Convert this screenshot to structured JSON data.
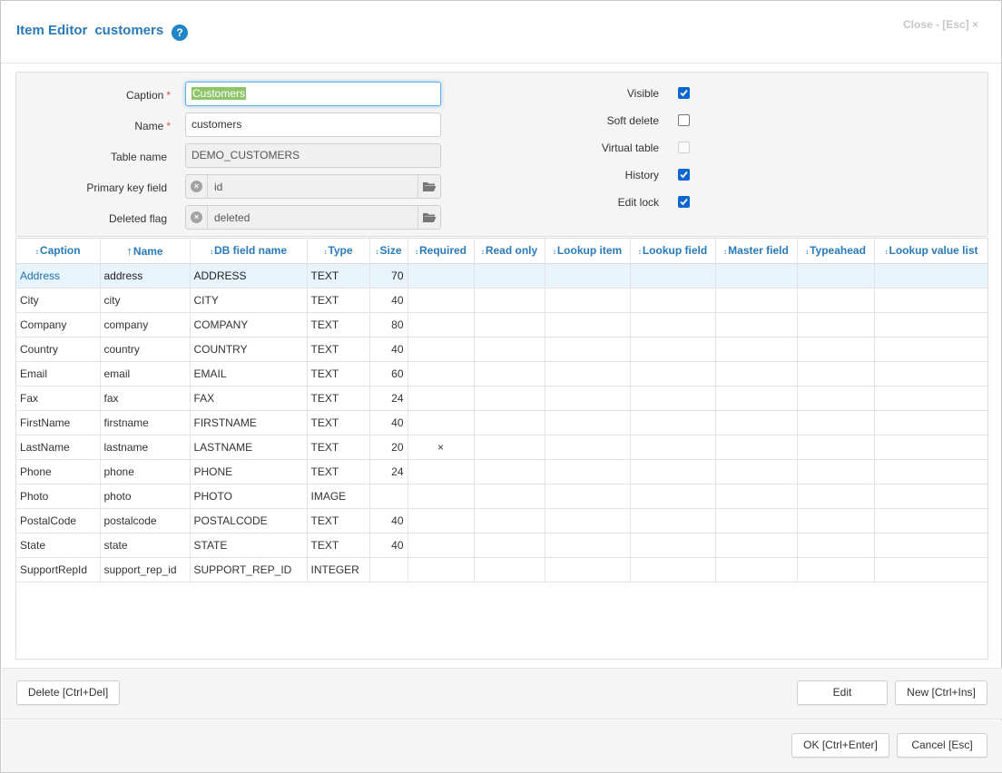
{
  "header": {
    "title": "Item Editor",
    "item_name": "customers",
    "help": "?",
    "close_label": "Close - [Esc] ×"
  },
  "form": {
    "caption_label": "Caption",
    "caption_value": "Customers",
    "name_label": "Name",
    "name_value": "customers",
    "table_name_label": "Table name",
    "table_name_value": "DEMO_CUSTOMERS",
    "primary_key_label": "Primary key field",
    "primary_key_value": "id",
    "deleted_flag_label": "Deleted flag",
    "deleted_flag_value": "deleted",
    "required_mark": "*",
    "checks": [
      {
        "label": "Visible",
        "checked": true,
        "disabled": false
      },
      {
        "label": "Soft delete",
        "checked": false,
        "disabled": false
      },
      {
        "label": "Virtual table",
        "checked": false,
        "disabled": true
      },
      {
        "label": "History",
        "checked": true,
        "disabled": false
      },
      {
        "label": "Edit lock",
        "checked": true,
        "disabled": false
      }
    ]
  },
  "grid": {
    "columns": [
      "Caption",
      "Name",
      "DB field name",
      "Type",
      "Size",
      "Required",
      "Read only",
      "Lookup item",
      "Lookup field",
      "Master field",
      "Typeahead",
      "Lookup value list"
    ],
    "rows": [
      [
        "Address",
        "address",
        "ADDRESS",
        "TEXT",
        "70",
        "",
        "",
        "",
        "",
        "",
        "",
        ""
      ],
      [
        "City",
        "city",
        "CITY",
        "TEXT",
        "40",
        "",
        "",
        "",
        "",
        "",
        "",
        ""
      ],
      [
        "Company",
        "company",
        "COMPANY",
        "TEXT",
        "80",
        "",
        "",
        "",
        "",
        "",
        "",
        ""
      ],
      [
        "Country",
        "country",
        "COUNTRY",
        "TEXT",
        "40",
        "",
        "",
        "",
        "",
        "",
        "",
        ""
      ],
      [
        "Email",
        "email",
        "EMAIL",
        "TEXT",
        "60",
        "",
        "",
        "",
        "",
        "",
        "",
        ""
      ],
      [
        "Fax",
        "fax",
        "FAX",
        "TEXT",
        "24",
        "",
        "",
        "",
        "",
        "",
        "",
        ""
      ],
      [
        "FirstName",
        "firstname",
        "FIRSTNAME",
        "TEXT",
        "40",
        "",
        "",
        "",
        "",
        "",
        "",
        ""
      ],
      [
        "LastName",
        "lastname",
        "LASTNAME",
        "TEXT",
        "20",
        "×",
        "",
        "",
        "",
        "",
        "",
        ""
      ],
      [
        "Phone",
        "phone",
        "PHONE",
        "TEXT",
        "24",
        "",
        "",
        "",
        "",
        "",
        "",
        ""
      ],
      [
        "Photo",
        "photo",
        "PHOTO",
        "IMAGE",
        "",
        "",
        "",
        "",
        "",
        "",
        "",
        ""
      ],
      [
        "PostalCode",
        "postalcode",
        "POSTALCODE",
        "TEXT",
        "40",
        "",
        "",
        "",
        "",
        "",
        "",
        ""
      ],
      [
        "State",
        "state",
        "STATE",
        "TEXT",
        "40",
        "",
        "",
        "",
        "",
        "",
        "",
        ""
      ],
      [
        "SupportRepId",
        "support_rep_id",
        "SUPPORT_REP_ID",
        "INTEGER",
        "",
        "",
        "",
        "",
        "",
        "",
        "",
        ""
      ]
    ]
  },
  "buttons": {
    "delete": "Delete [Ctrl+Del]",
    "edit": "Edit",
    "new": "New [Ctrl+Ins]",
    "ok": "OK [Ctrl+Enter]",
    "cancel": "Cancel [Esc]"
  }
}
